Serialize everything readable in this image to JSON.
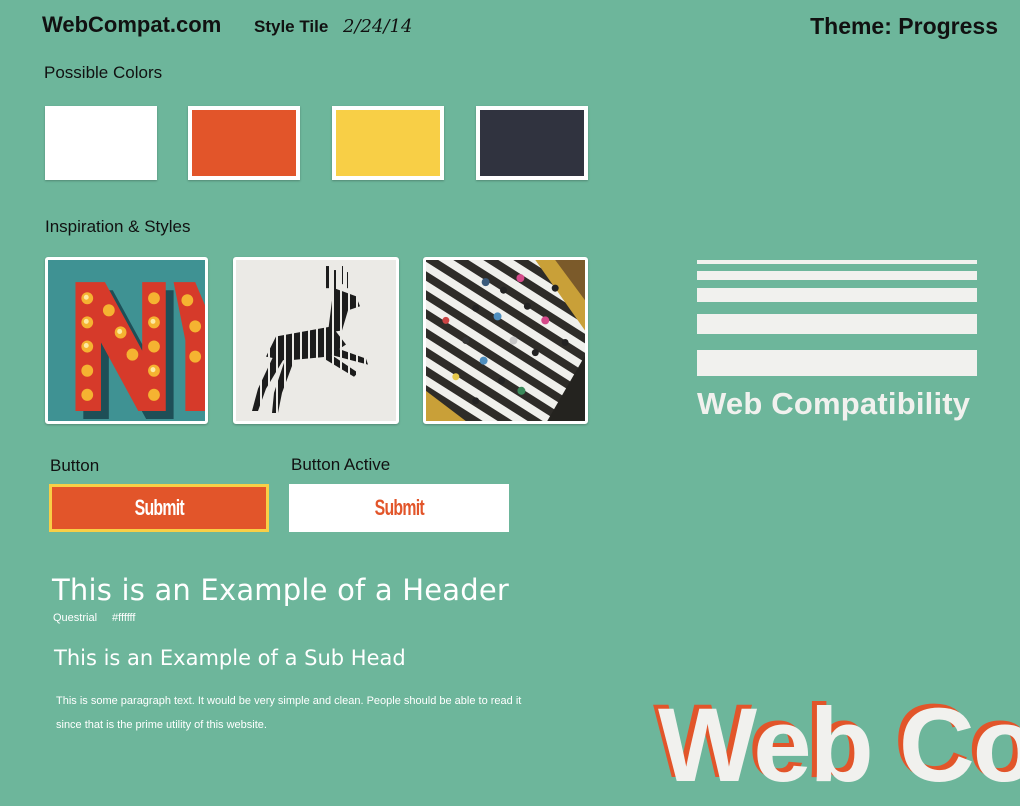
{
  "header": {
    "brand": "WebCompat.com",
    "tile_label": "Style Tile",
    "date": "2/24/14",
    "theme": "Theme: Progress"
  },
  "colors": {
    "label": "Possible Colors",
    "swatches": [
      {
        "name": "white",
        "hex": "#ffffff"
      },
      {
        "name": "orange",
        "hex": "#e2552a"
      },
      {
        "name": "yellow",
        "hex": "#f8cf46"
      },
      {
        "name": "navy",
        "hex": "#30333f"
      }
    ],
    "background": "#6db69b"
  },
  "inspiration": {
    "label": "Inspiration & Styles",
    "images": [
      "marquee-letters-image",
      "leaping-deer-image",
      "crosswalk-crowd-image"
    ]
  },
  "logo": {
    "text": "Web Compatibility",
    "stripe_count": 5
  },
  "buttons": {
    "button_label": "Button",
    "button_active_label": "Button Active",
    "submit_text": "Submit",
    "submit_active_text": "Submit"
  },
  "typography": {
    "header_sample": "This is an Example of a Header",
    "font_name": "Questrial",
    "font_color": "#ffffff",
    "subhead_sample": "This is an Example of a Sub Head",
    "paragraph_sample": "This is some paragraph text.  It would be very simple and clean.  People should be able to read it since that is the prime utility of this website."
  },
  "decorative": {
    "big_word": "Web Co"
  }
}
